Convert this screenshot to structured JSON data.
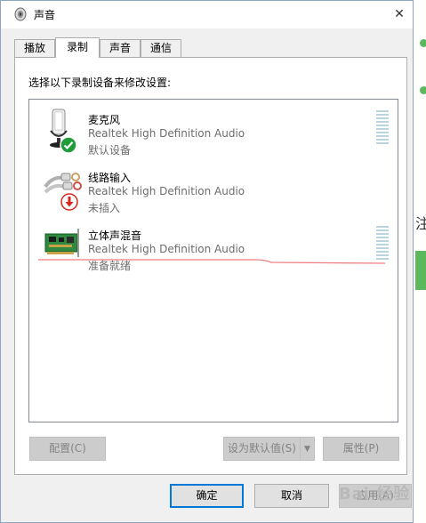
{
  "window": {
    "title": "声音",
    "close_glyph": "✕"
  },
  "tabs": [
    {
      "label": "播放"
    },
    {
      "label": "录制"
    },
    {
      "label": "声音"
    },
    {
      "label": "通信"
    }
  ],
  "active_tab": "录制",
  "instruction": "选择以下录制设备来修改设置:",
  "devices": [
    {
      "name": "麦克风",
      "driver": "Realtek High Definition Audio",
      "status": "默认设备",
      "icon": "microphone-icon",
      "badge": "check-icon"
    },
    {
      "name": "线路输入",
      "driver": "Realtek High Definition Audio",
      "status": "未插入",
      "icon": "line-in-cable-icon",
      "badge": "down-arrow-icon"
    },
    {
      "name": "立体声混音",
      "driver": "Realtek High Definition Audio",
      "status": "准备就绪",
      "icon": "sound-card-icon",
      "badge": ""
    }
  ],
  "buttons": {
    "configure": "配置(C)",
    "set_default": "设为默认值(S)",
    "properties": "属性(P)",
    "ok": "确定",
    "cancel": "取消",
    "apply": "应用(A)"
  },
  "watermark": "Bai 经验",
  "colors": {
    "accent": "#0078d7",
    "check": "#1f9d3a",
    "badge_red": "#d9261c",
    "meter": "#bcd5dd"
  }
}
